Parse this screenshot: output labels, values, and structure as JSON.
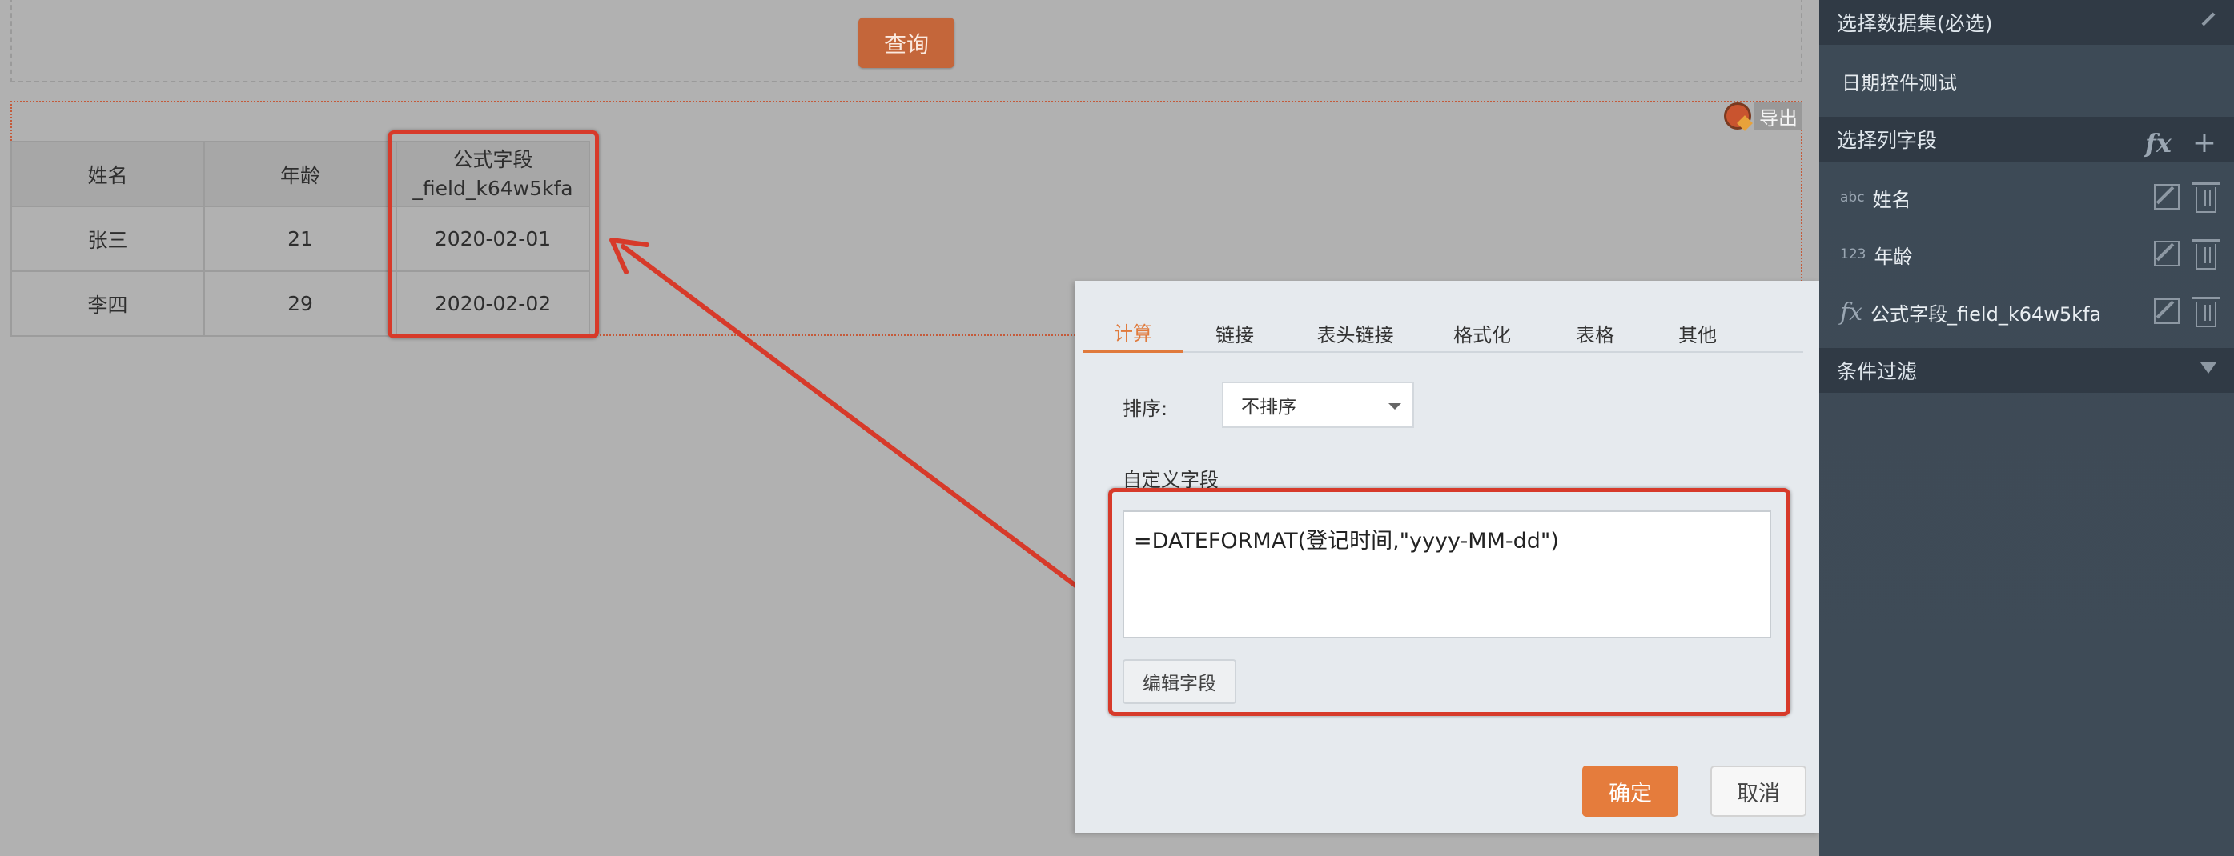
{
  "report": {
    "query_label": "查询",
    "export_label": "导出",
    "table": {
      "headers": [
        "姓名",
        "年龄",
        "公式字段_field_k64w5kfa"
      ],
      "rows": [
        [
          "张三",
          "21",
          "2020-02-01"
        ],
        [
          "李四",
          "29",
          "2020-02-02"
        ]
      ]
    }
  },
  "dialog": {
    "tabs": [
      {
        "label": "计算",
        "active": true
      },
      {
        "label": "链接"
      },
      {
        "label": "表头链接"
      },
      {
        "label": "格式化"
      },
      {
        "label": "表格"
      },
      {
        "label": "其他"
      }
    ],
    "sort_label": "排序:",
    "sort_value": "不排序",
    "custom_field_label": "自定义字段",
    "formula": "=DATEFORMAT(登记时间,\"yyyy-MM-dd\")",
    "edit_field_label": "编辑字段",
    "ok_label": "确定",
    "cancel_label": "取消"
  },
  "sidebar": {
    "dataset_header": "选择数据集(必选)",
    "dataset_value": "日期控件测试",
    "columns_header": "选择列字段",
    "columns": [
      {
        "type": "abc",
        "label": "姓名"
      },
      {
        "type": "123",
        "label": "年龄"
      },
      {
        "type": "fx",
        "label": "公式字段_field_k64w5kfa"
      }
    ],
    "filter_header": "条件过滤"
  },
  "colors": {
    "accent": "#e57c3c",
    "highlight": "#d73a2a",
    "sidebar_bg": "#3e4b57"
  }
}
